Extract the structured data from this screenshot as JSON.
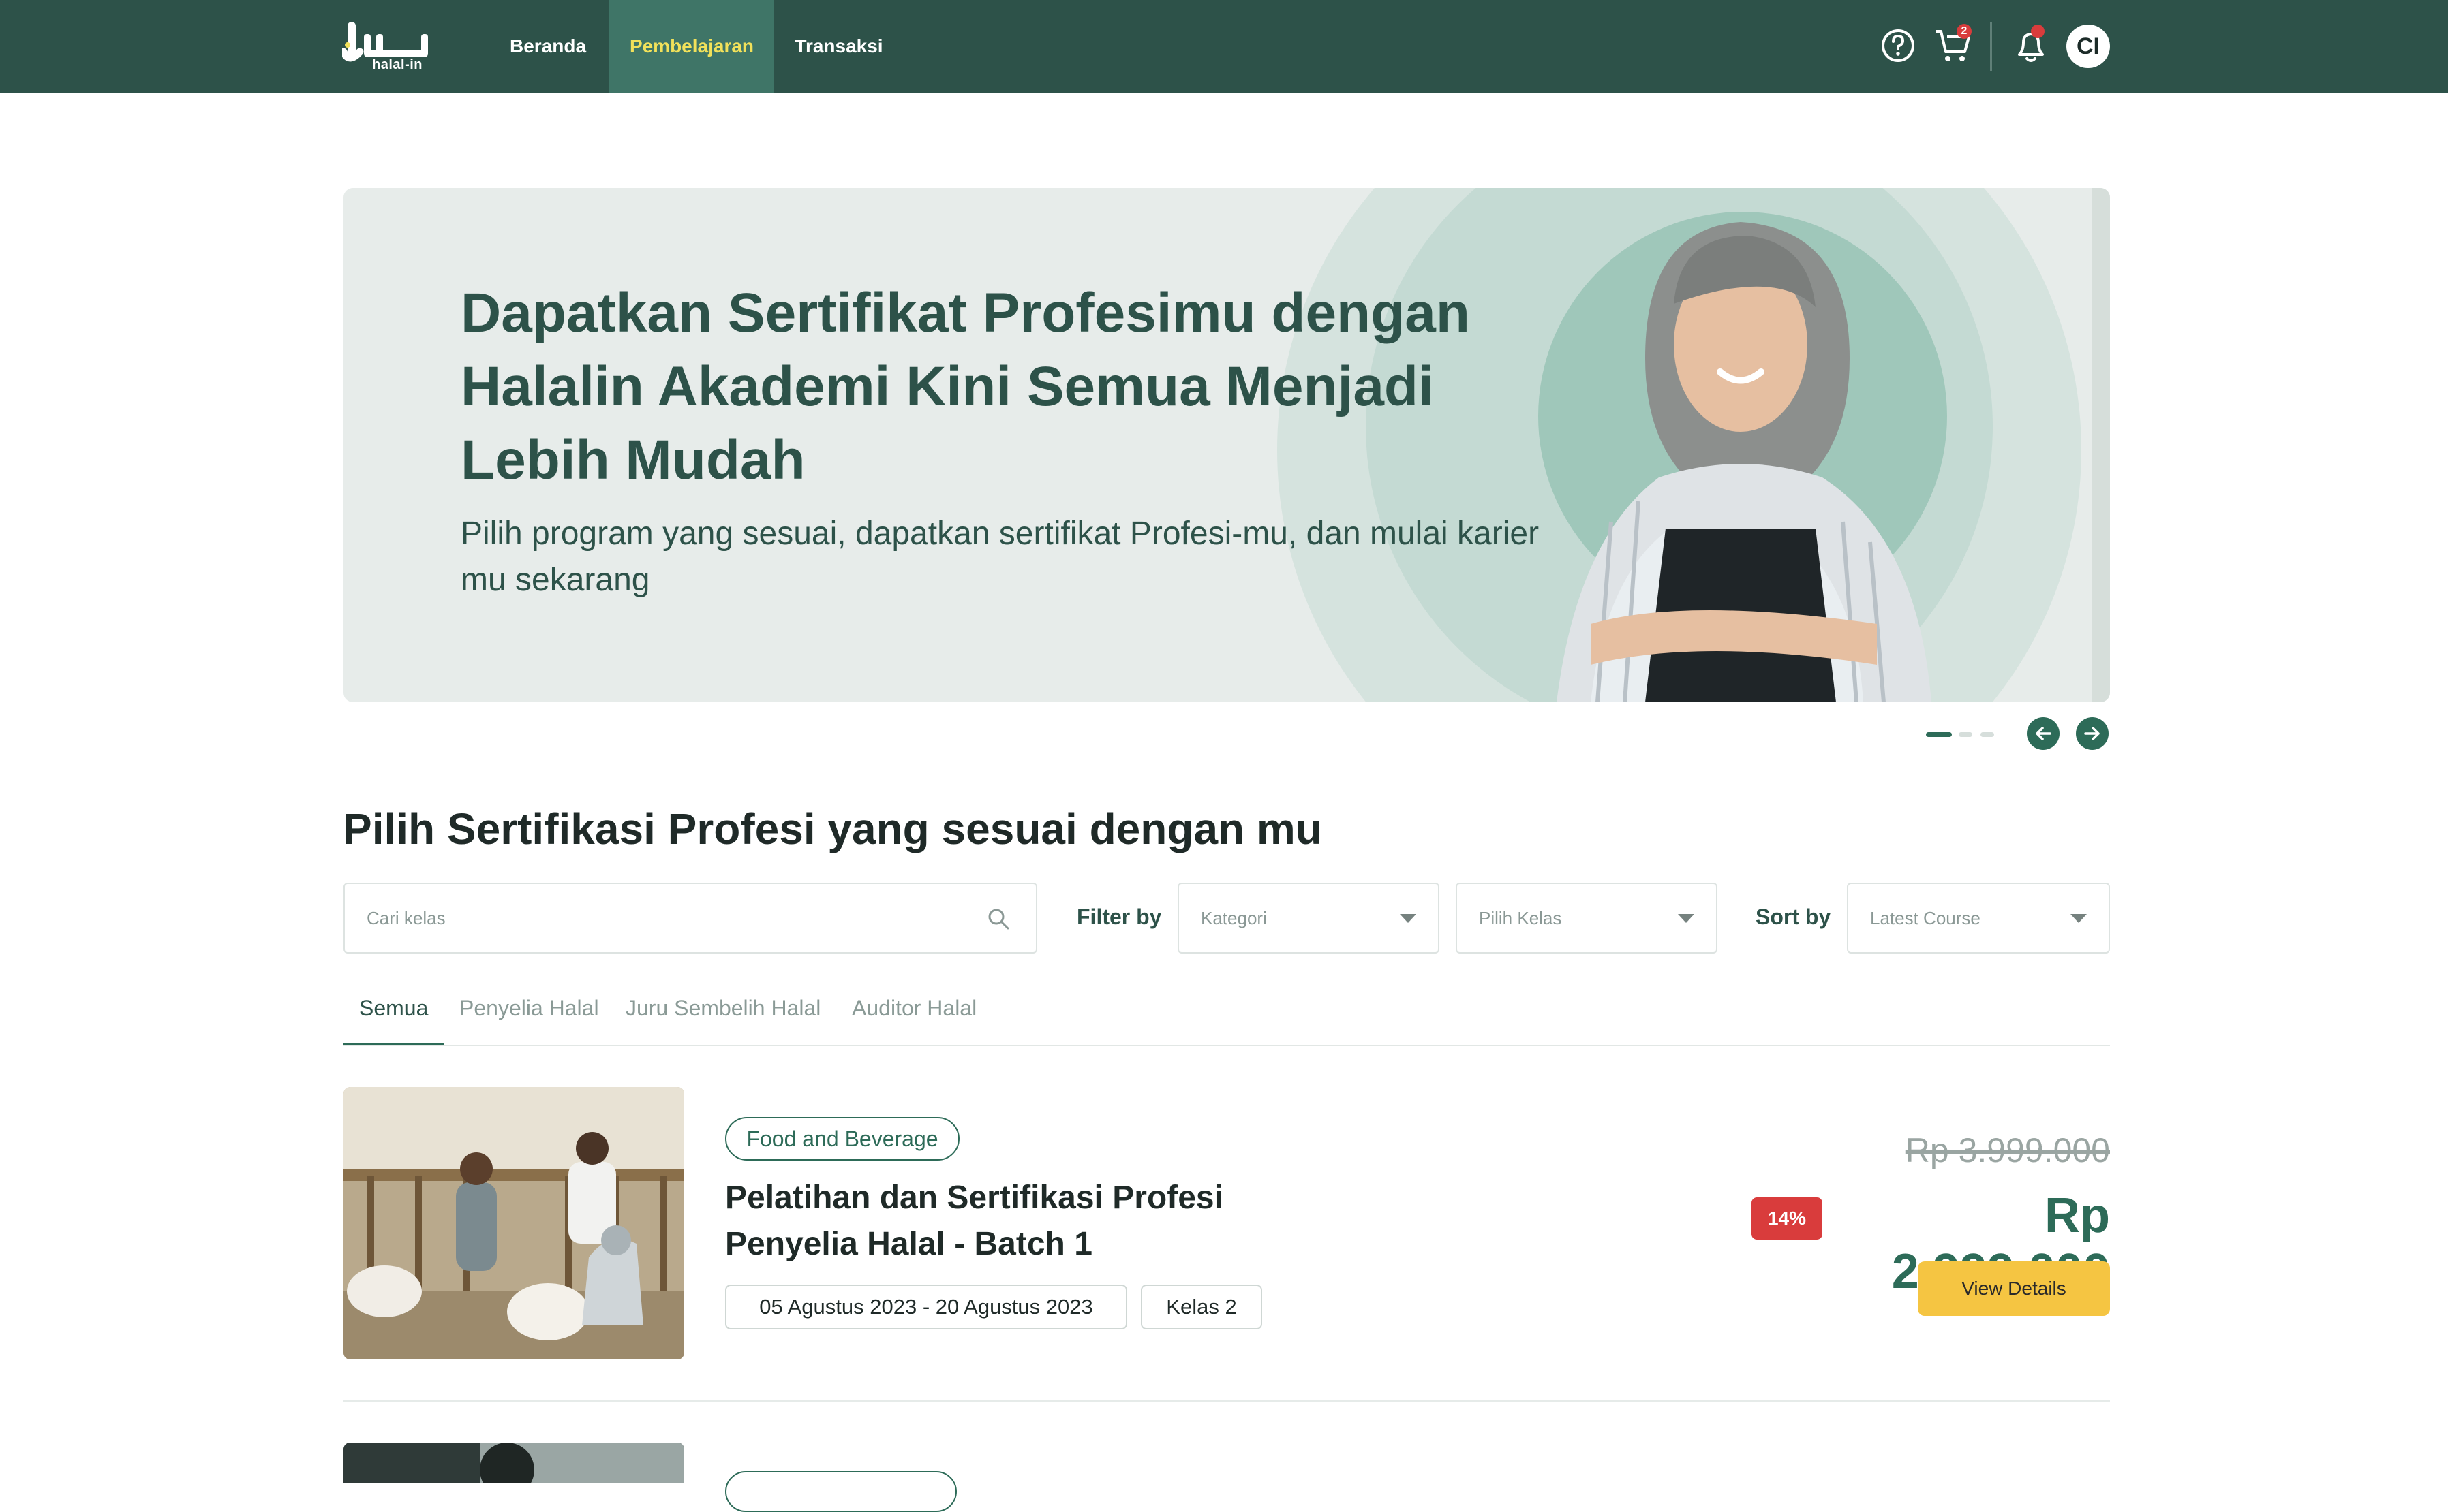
{
  "brand": {
    "logo_text": "halal-in"
  },
  "nav": {
    "items": [
      {
        "label": "Beranda"
      },
      {
        "label": "Pembelajaran"
      },
      {
        "label": "Transaksi"
      }
    ],
    "active": "Pembelajaran",
    "cart_count": "2",
    "avatar_initials": "CI"
  },
  "hero": {
    "title": "Dapatkan Sertifikat Profesimu dengan Halalin Akademi Kini Semua Menjadi Lebih Mudah",
    "subtitle": "Pilih program yang sesuai, dapatkan sertifikat Profesi-mu, dan mulai karier mu sekarang"
  },
  "section": {
    "title": "Pilih Sertifikasi Profesi yang sesuai dengan mu"
  },
  "filters": {
    "search_placeholder": "Cari kelas",
    "filter_label": "Filter by",
    "category_value": "Kategori",
    "class_value": "Pilih Kelas",
    "sort_label": "Sort by",
    "sort_value": "Latest Course"
  },
  "tabs": [
    {
      "label": "Semua"
    },
    {
      "label": "Penyelia Halal"
    },
    {
      "label": "Juru Sembelih Halal"
    },
    {
      "label": "Auditor Halal"
    }
  ],
  "courses": [
    {
      "category": "Food and Beverage",
      "title": "Pelatihan dan Sertifikasi Profesi Penyelia Halal - Batch 1",
      "dates": "05 Agustus 2023 - 20 Agustus 2023",
      "class": "Kelas 2",
      "old_price": "Rp 3.999.000",
      "discount": "14%",
      "price": "Rp 2.999.000",
      "button": "View Details"
    }
  ],
  "colors": {
    "primary": "#2d5249",
    "accent_yellow": "#f5c542",
    "discount_red": "#d93c3c",
    "active_nav_text": "#f2e15a"
  }
}
